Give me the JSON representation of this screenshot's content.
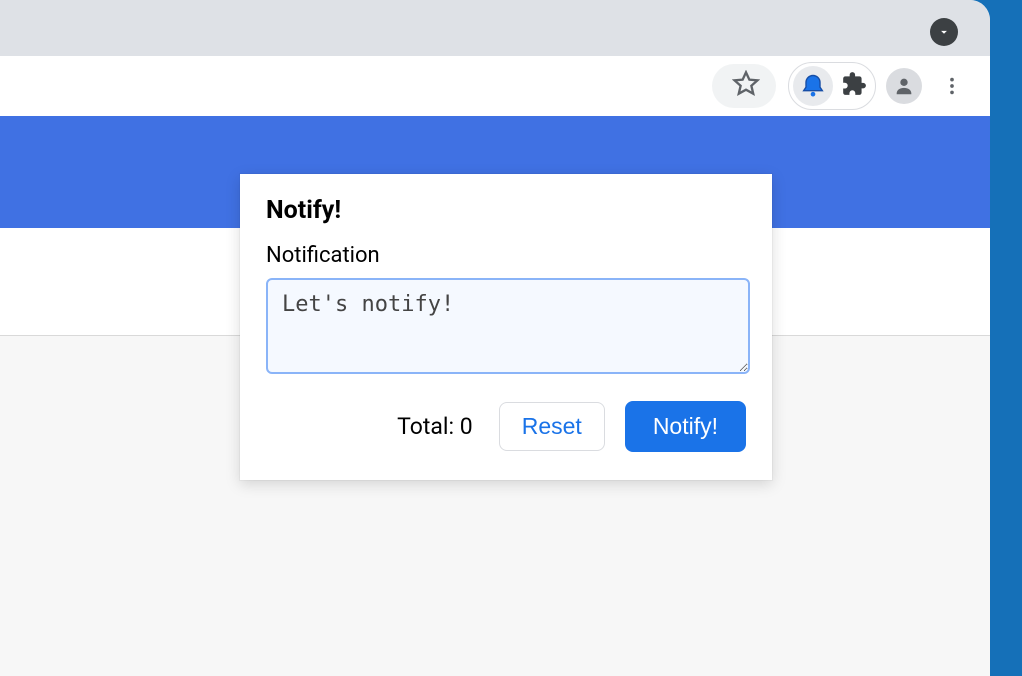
{
  "toolbar": {
    "star_icon": "star-icon",
    "bell_icon": "bell-icon",
    "extensions_icon": "extensions-icon",
    "profile_icon": "profile-icon",
    "menu_icon": "menu-icon"
  },
  "popup": {
    "title": "Notify!",
    "field_label": "Notification",
    "textarea_value": "Let's notify!",
    "textarea_placeholder": "",
    "total_label": "Total: ",
    "total_value": "0",
    "reset_label": "Reset",
    "notify_label": "Notify!"
  },
  "colors": {
    "accent": "#1a73e8",
    "band": "#4071e3",
    "desktop": "#1570b8"
  }
}
